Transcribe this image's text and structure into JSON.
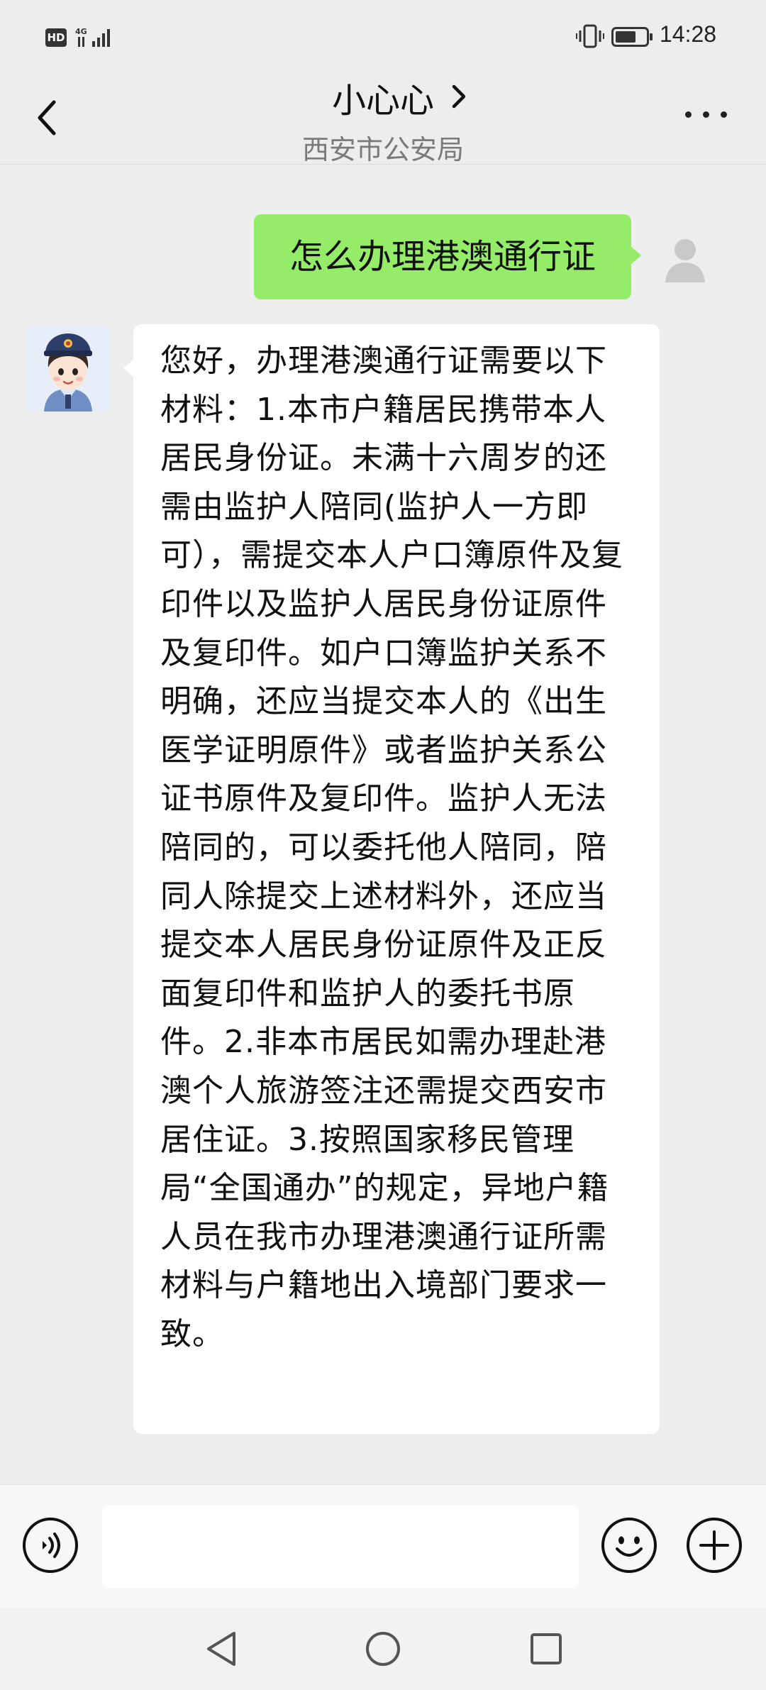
{
  "status_bar": {
    "network_badge": "HD",
    "network_type": "4G",
    "time": "14:28"
  },
  "header": {
    "title": "小心心",
    "subtitle": "西安市公安局"
  },
  "messages": {
    "outgoing": {
      "text": "怎么办理港澳通行证"
    },
    "incoming": {
      "text": "您好，办理港澳通行证需要以下材料：1.本市户籍居民携带本人居民身份证。未满十六周岁的还需由监护人陪同(监护人一方即可），需提交本人户口簿原件及复印件以及监护人居民身份证原件及复印件。如户口簿监护关系不明确，还应当提交本人的《出生医学证明原件》或者监护关系公证书原件及复印件。监护人无法陪同的，可以委托他人陪同，陪同人除提交上述材料外，还应当提交本人居民身份证原件及正反面复印件和监护人的委托书原件。2.非本市居民如需办理赴港澳个人旅游签注还需提交西安市居住证。3.按照国家移民管理局“全国通办”的规定，异地户籍人员在我市办理港澳通行证所需材料与户籍地出入境部门要求一致。"
    }
  },
  "input_bar": {
    "message_value": ""
  },
  "colors": {
    "background": "#ededed",
    "outgoing_bubble": "#95ec69",
    "incoming_bubble": "#ffffff",
    "subtitle_text": "#7a7a7a"
  },
  "icons": {
    "back": "chevron-left-icon",
    "title_more": "chevron-right-icon",
    "menu": "more-dots-icon",
    "voice": "voice-icon",
    "emoji": "emoji-icon",
    "plus": "plus-icon",
    "nav_back": "triangle-back-icon",
    "nav_home": "circle-home-icon",
    "nav_recents": "square-recents-icon"
  }
}
